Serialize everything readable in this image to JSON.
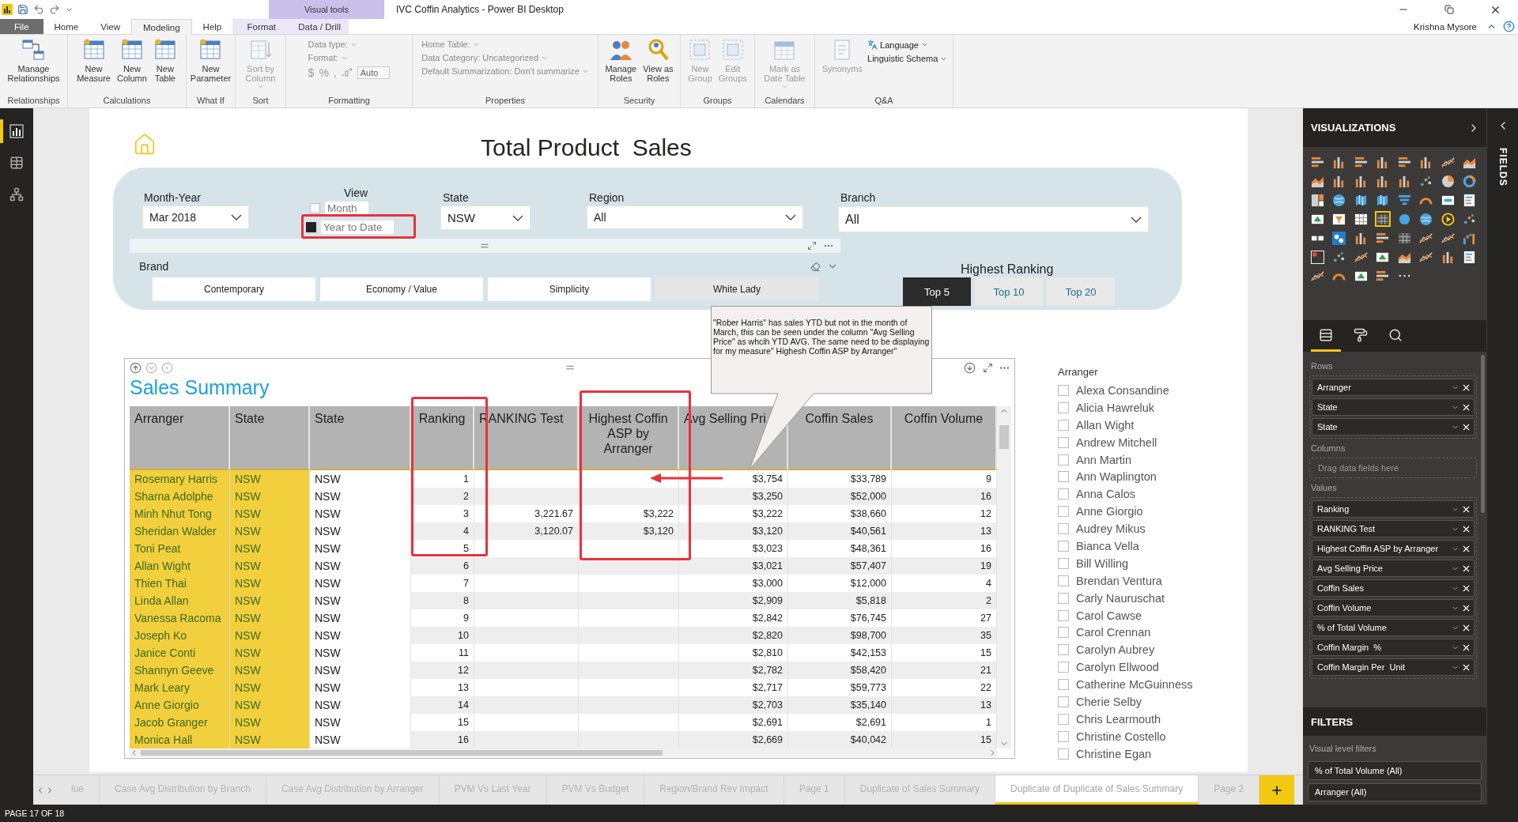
{
  "title_bar": {
    "contextual_group": "Visual tools",
    "title": "IVC Coffin Analytics - Power BI Desktop",
    "user": "Krishna Mysore"
  },
  "ribbon_tabs": [
    {
      "label": "File",
      "kind": "file",
      "selected": false
    },
    {
      "label": "Home",
      "kind": "normal",
      "selected": false
    },
    {
      "label": "View",
      "kind": "normal",
      "selected": false
    },
    {
      "label": "Modeling",
      "kind": "normal",
      "selected": true
    },
    {
      "label": "Help",
      "kind": "normal",
      "selected": false
    },
    {
      "label": "Format",
      "kind": "contextual",
      "selected": false
    },
    {
      "label": "Data / Drill",
      "kind": "contextual",
      "selected": false
    }
  ],
  "ribbon_groups": [
    {
      "label": "Relationships",
      "items": [
        {
          "kind": "large",
          "lines": [
            "Manage",
            "Relationships"
          ],
          "disabled": false
        }
      ]
    },
    {
      "label": "Calculations",
      "items": [
        {
          "kind": "large",
          "lines": [
            "New",
            "Measure"
          ],
          "disabled": false
        },
        {
          "kind": "large",
          "lines": [
            "New",
            "Column"
          ],
          "disabled": false
        },
        {
          "kind": "large",
          "lines": [
            "New",
            "Table"
          ],
          "disabled": false
        }
      ]
    },
    {
      "label": "What If",
      "items": [
        {
          "kind": "large",
          "lines": [
            "New",
            "Parameter"
          ],
          "disabled": false
        }
      ]
    },
    {
      "label": "Sort",
      "items": [
        {
          "kind": "large",
          "lines": [
            "Sort by",
            "Column"
          ],
          "dropdown": true,
          "disabled": true
        }
      ]
    },
    {
      "label": "Formatting",
      "items": [
        {
          "kind": "stack",
          "rows": [
            {
              "kind": "dropdown",
              "label": "Data type:",
              "disabled": true
            },
            {
              "kind": "dropdown",
              "label": "Format:",
              "disabled": true
            },
            {
              "kind": "symbols",
              "symbols": [
                "$",
                "%",
                ","
              ],
              "value": "Auto",
              "disabled": true
            }
          ]
        }
      ]
    },
    {
      "label": "Properties",
      "items": [
        {
          "kind": "stack",
          "rows": [
            {
              "kind": "dropdown",
              "label": "Home Table:",
              "disabled": true
            },
            {
              "kind": "dropdown",
              "label": "Data Category: Uncategorized",
              "disabled": true
            },
            {
              "kind": "dropdown",
              "label": "Default Summarization: Don't summarize",
              "disabled": true
            }
          ]
        }
      ]
    },
    {
      "label": "Security",
      "items": [
        {
          "kind": "large",
          "lines": [
            "Manage",
            "Roles"
          ],
          "disabled": false
        },
        {
          "kind": "large",
          "lines": [
            "View as",
            "Roles"
          ],
          "disabled": false
        }
      ]
    },
    {
      "label": "Groups",
      "items": [
        {
          "kind": "large",
          "lines": [
            "New",
            "Group"
          ],
          "disabled": true
        },
        {
          "kind": "large",
          "lines": [
            "Edit",
            "Groups"
          ],
          "disabled": true
        }
      ]
    },
    {
      "label": "Calendars",
      "items": [
        {
          "kind": "large",
          "lines": [
            "Mark as",
            "Date Table"
          ],
          "dropdown": true,
          "disabled": true
        }
      ]
    },
    {
      "label": "Q&A",
      "items": [
        {
          "kind": "large",
          "lines": [
            "Synonyms"
          ],
          "disabled": true
        },
        {
          "kind": "stack",
          "rows": [
            {
              "kind": "language",
              "label": "Language",
              "disabled": false
            },
            {
              "kind": "dropdown",
              "label": "Linguistic Schema",
              "disabled": false
            }
          ]
        }
      ]
    }
  ],
  "views": [
    {
      "selected": true
    },
    {
      "selected": false
    },
    {
      "selected": false
    }
  ],
  "report": {
    "title": "Total Product  Sales",
    "month_year": {
      "label": "Month-Year",
      "value": "Mar 2018"
    },
    "view": {
      "label": "View",
      "options": [
        {
          "label": "Month",
          "checked": false
        },
        {
          "label": "Year to Date",
          "checked": true
        }
      ]
    },
    "state": {
      "label": "State",
      "value": "NSW"
    },
    "region": {
      "label": "Region",
      "value": "All"
    },
    "branch": {
      "label": "Branch",
      "value": "All"
    },
    "brand": {
      "label": "Brand",
      "options": [
        {
          "label": "Contemporary",
          "hovered": false
        },
        {
          "label": "Economy / Value",
          "hovered": false
        },
        {
          "label": "Simplicity",
          "hovered": false
        },
        {
          "label": "White Lady",
          "hovered": true
        }
      ]
    },
    "highest_ranking": {
      "label": "Highest Ranking",
      "options": [
        {
          "label": "Top 5",
          "selected": true
        },
        {
          "label": "Top 10",
          "selected": false
        },
        {
          "label": "Top 20",
          "selected": false
        }
      ]
    },
    "callout": "\"Rober Harris\" has sales YTD but not in the month of March,  this can be seen  under the column \"Avg Selling Price\" as whcih YTD AVG. The same need to be displaying for my measure\" Highesh Coffin ASP by Arranger\"",
    "table": {
      "title": "Sales Summary",
      "columns": [
        "Arranger",
        "State",
        "State",
        "Ranking",
        "RANKING Test",
        "Highest Coffin ASP by Arranger",
        "Avg Selling Pri",
        "Coffin Sales",
        "Coffin Volume"
      ],
      "rows": [
        [
          "Rosemary Harris",
          "NSW",
          "NSW",
          "1",
          null,
          null,
          "$3,754",
          "$33,789",
          "9"
        ],
        [
          "Sharna Adolphe",
          "NSW",
          "NSW",
          "2",
          null,
          null,
          "$3,250",
          "$52,000",
          "16"
        ],
        [
          "Minh Nhut Tong",
          "NSW",
          "NSW",
          "3",
          "3,221.67",
          "$3,222",
          "$3,222",
          "$38,660",
          "12"
        ],
        [
          "Sheridan Walder",
          "NSW",
          "NSW",
          "4",
          "3,120.07",
          "$3,120",
          "$3,120",
          "$40,561",
          "13"
        ],
        [
          "Toni Peat",
          "NSW",
          "NSW",
          "5",
          null,
          null,
          "$3,023",
          "$48,361",
          "16"
        ],
        [
          "Allan Wight",
          "NSW",
          "NSW",
          "6",
          null,
          null,
          "$3,021",
          "$57,407",
          "19"
        ],
        [
          "Thien Thai",
          "NSW",
          "NSW",
          "7",
          null,
          null,
          "$3,000",
          "$12,000",
          "4"
        ],
        [
          "Linda Allan",
          "NSW",
          "NSW",
          "8",
          null,
          null,
          "$2,909",
          "$5,818",
          "2"
        ],
        [
          "Vanessa Racoma",
          "NSW",
          "NSW",
          "9",
          null,
          null,
          "$2,842",
          "$76,745",
          "27"
        ],
        [
          "Joseph Ko",
          "NSW",
          "NSW",
          "10",
          null,
          null,
          "$2,820",
          "$98,700",
          "35"
        ],
        [
          "Janice Conti",
          "NSW",
          "NSW",
          "11",
          null,
          null,
          "$2,810",
          "$42,153",
          "15"
        ],
        [
          "Shannyn Geeve",
          "NSW",
          "NSW",
          "12",
          null,
          null,
          "$2,782",
          "$58,420",
          "21"
        ],
        [
          "Mark Leary",
          "NSW",
          "NSW",
          "13",
          null,
          null,
          "$2,717",
          "$59,773",
          "22"
        ],
        [
          "Anne Giorgio",
          "NSW",
          "NSW",
          "14",
          null,
          null,
          "$2,703",
          "$35,140",
          "13"
        ],
        [
          "Jacob Granger",
          "NSW",
          "NSW",
          "15",
          null,
          null,
          "$2,691",
          "$2,691",
          "1"
        ],
        [
          "Monica Hall",
          "NSW",
          "NSW",
          "16",
          null,
          null,
          "$2,669",
          "$40,042",
          "15"
        ]
      ]
    },
    "arranger_slicer": {
      "label": "Arranger",
      "items": [
        {
          "label": "Alexa Consandine",
          "checked": false
        },
        {
          "label": "Alicia Hawreluk",
          "checked": false
        },
        {
          "label": "Allan Wight",
          "checked": false
        },
        {
          "label": "Andrew Mitchell",
          "checked": false
        },
        {
          "label": "Ann Martin",
          "checked": false
        },
        {
          "label": "Ann Waplington",
          "checked": false
        },
        {
          "label": "Anna Calos",
          "checked": false
        },
        {
          "label": "Anne Giorgio",
          "checked": false
        },
        {
          "label": "Audrey Mikus",
          "checked": false
        },
        {
          "label": "Bianca Vella",
          "checked": false
        },
        {
          "label": "Bill Willing",
          "checked": false
        },
        {
          "label": "Brendan Ventura",
          "checked": false
        },
        {
          "label": "Carly Nauruschat",
          "checked": false
        },
        {
          "label": "Carol Cawse",
          "checked": false
        },
        {
          "label": "Carol Crennan",
          "checked": false
        },
        {
          "label": "Carolyn Aubrey",
          "checked": false
        },
        {
          "label": "Carolyn Ellwood",
          "checked": false
        },
        {
          "label": "Catherine McGuinness",
          "checked": false
        },
        {
          "label": "Cherie Selby",
          "checked": false
        },
        {
          "label": "Chris Learmouth",
          "checked": false
        },
        {
          "label": "Christine Costello",
          "checked": false
        },
        {
          "label": "Christine Egan",
          "checked": false
        }
      ]
    }
  },
  "visualizations": {
    "title": "VISUALIZATIONS",
    "gallery": [
      {
        "kind": "hbar",
        "selected": false
      },
      {
        "kind": "column",
        "selected": false
      },
      {
        "kind": "hbar",
        "selected": false
      },
      {
        "kind": "column",
        "selected": false
      },
      {
        "kind": "hbar",
        "selected": false
      },
      {
        "kind": "column",
        "selected": false
      },
      {
        "kind": "line",
        "selected": false
      },
      {
        "kind": "area",
        "selected": false
      },
      {
        "kind": "area",
        "selected": false
      },
      {
        "kind": "column",
        "selected": false
      },
      {
        "kind": "column",
        "selected": false
      },
      {
        "kind": "column",
        "selected": false
      },
      {
        "kind": "column",
        "selected": false
      },
      {
        "kind": "scatter",
        "selected": false
      },
      {
        "kind": "pie",
        "selected": false
      },
      {
        "kind": "donut",
        "selected": false
      },
      {
        "kind": "treemap",
        "selected": false
      },
      {
        "kind": "globe",
        "selected": false
      },
      {
        "kind": "map",
        "selected": false
      },
      {
        "kind": "map",
        "selected": false
      },
      {
        "kind": "funnel",
        "selected": false
      },
      {
        "kind": "gauge",
        "selected": false
      },
      {
        "kind": "card",
        "selected": false
      },
      {
        "kind": "list",
        "selected": false
      },
      {
        "kind": "kpi",
        "selected": false
      },
      {
        "kind": "slicer",
        "selected": false
      },
      {
        "kind": "table",
        "selected": false
      },
      {
        "kind": "matrix",
        "selected": true
      },
      {
        "kind": "circle",
        "selected": false
      },
      {
        "kind": "globe",
        "selected": false
      },
      {
        "kind": "play",
        "selected": false
      },
      {
        "kind": "scatter",
        "selected": false
      },
      {
        "kind": "cards",
        "selected": false
      },
      {
        "kind": "nodes",
        "selected": false
      },
      {
        "kind": "column",
        "selected": false
      },
      {
        "kind": "hbar",
        "selected": false
      },
      {
        "kind": "matrix",
        "selected": false
      },
      {
        "kind": "line",
        "selected": false
      },
      {
        "kind": "line",
        "selected": false
      },
      {
        "kind": "waterfall",
        "selected": false
      },
      {
        "kind": "dots",
        "selected": false
      },
      {
        "kind": "scatter",
        "selected": false
      },
      {
        "kind": "line",
        "selected": false
      },
      {
        "kind": "kpi",
        "selected": false
      },
      {
        "kind": "area",
        "selected": false
      },
      {
        "kind": "line",
        "selected": false
      },
      {
        "kind": "column",
        "selected": false
      },
      {
        "kind": "list",
        "selected": false
      },
      {
        "kind": "line",
        "selected": false
      },
      {
        "kind": "gauge",
        "selected": false
      },
      {
        "kind": "kpi",
        "selected": false
      },
      {
        "kind": "hbar",
        "selected": false
      },
      {
        "kind": "more",
        "selected": false
      }
    ],
    "tabs": [
      {
        "selected": true
      },
      {
        "selected": false
      },
      {
        "selected": false
      }
    ],
    "wells": [
      {
        "label": "Rows",
        "fields": [
          "Arranger",
          "State",
          "State"
        ]
      },
      {
        "label": "Columns",
        "placeholder": "Drag data fields here"
      },
      {
        "label": "Values",
        "fields": [
          "Ranking",
          "RANKING Test",
          "Highest Coffin ASP by Arranger",
          "Avg Selling Price",
          "Coffin Sales",
          "Coffin Volume",
          "% of Total Volume",
          "Coffin Margin  %",
          "Coffin Margin Per  Unit"
        ]
      }
    ]
  },
  "filters": {
    "title": "FILTERS",
    "section": "Visual level filters",
    "items": [
      "% of Total Volume (All)",
      "Arranger (All)"
    ]
  },
  "fields_pane": {
    "title": "FIELDS"
  },
  "page_tabs": [
    {
      "label": "lue",
      "selected": false
    },
    {
      "label": "Case Avg Distribution by Branch",
      "selected": false
    },
    {
      "label": "Case Avg Distribution by Arranger",
      "selected": false
    },
    {
      "label": "PVM Vs Last Year",
      "selected": false
    },
    {
      "label": "PVM Vs Budget",
      "selected": false
    },
    {
      "label": "Region/Brand Rev Impact",
      "selected": false
    },
    {
      "label": "Page 1",
      "selected": false
    },
    {
      "label": "Duplicate of Sales Summary",
      "selected": false
    },
    {
      "label": "Duplicate of Duplicate of Sales Summary",
      "selected": true
    },
    {
      "label": "Page 2",
      "selected": false
    }
  ],
  "status_bar": "PAGE 17 OF 18"
}
